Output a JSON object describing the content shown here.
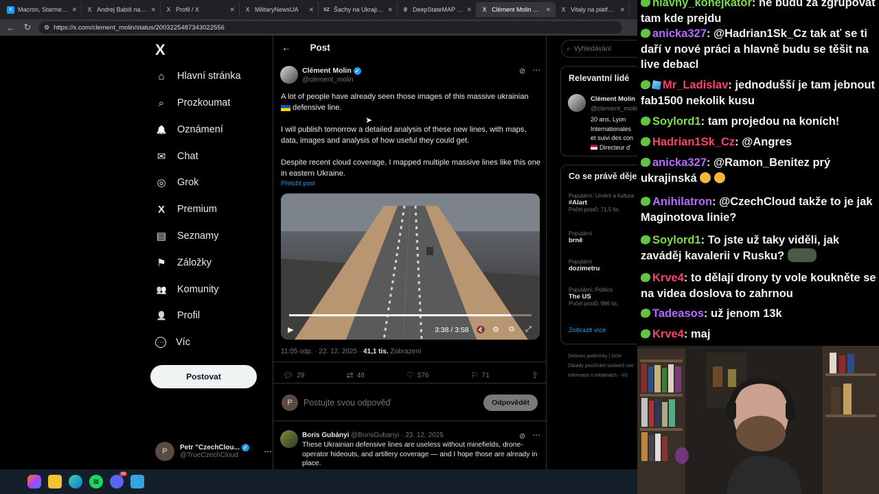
{
  "browser": {
    "tabs": [
      {
        "label": "Macron, Starmer a Ze",
        "icon": "X"
      },
      {
        "label": "Andrej Babiš na platf",
        "icon": "X"
      },
      {
        "label": "Profil / X",
        "icon": "X"
      },
      {
        "label": "MilitaryNewsUA",
        "icon": "X"
      },
      {
        "label": "Šachy na Ukrajině. Z",
        "icon": "SZ"
      },
      {
        "label": "DeepStateMAP | Дел",
        "icon": "₴"
      },
      {
        "label": "Clément Molin na pl",
        "icon": "X"
      },
      {
        "label": "Vitaly na platformě X",
        "icon": "X"
      }
    ],
    "url": "https://x.com/clement_molin/status/2003225487343022556"
  },
  "x": {
    "logo": "X",
    "nav": [
      {
        "label": "Hlavní stránka",
        "icon": "⌂"
      },
      {
        "label": "Prozkoumat",
        "icon": "⌕"
      },
      {
        "label": "Oznámení",
        "icon": "🔔"
      },
      {
        "label": "Chat",
        "icon": "✉"
      },
      {
        "label": "Grok",
        "icon": "◎"
      },
      {
        "label": "Premium",
        "icon": "X"
      },
      {
        "label": "Seznamy",
        "icon": "▤"
      },
      {
        "label": "Záložky",
        "icon": "⚑"
      },
      {
        "label": "Komunity",
        "icon": "👥"
      },
      {
        "label": "Profil",
        "icon": "👤"
      },
      {
        "label": "Víc",
        "icon": "⋯"
      }
    ],
    "post_button": "Postovat",
    "account": {
      "name": "Petr \"CzechClou...",
      "handle": "@TrueCzechCloud"
    },
    "header": {
      "back": "←",
      "title": "Post"
    },
    "post": {
      "author": "Clément Molin",
      "handle": "@clement_molin",
      "p1a": "A lot of people have already seen those images of this massive ukrainian",
      "p1b": "defensive line.",
      "p2": "I will publish tomorrow a detailed analysis of these new lines, with maps, data, images and analysis of how useful they could get.",
      "p3": "Despite recent cloud coverage, I mapped multiple massive lines like this one in eastern Ukraine.",
      "translate": "Přeložit post",
      "video_time": "3:38 / 3:58",
      "video_progress": 0.914,
      "timestamp": "11:05 odp. · 22. 12. 2025 ·",
      "views": "41,1 tis.",
      "views_label": "Zobrazení",
      "replies": "29",
      "reposts": "48",
      "likes": "576",
      "bookmarks": "71"
    },
    "reply_box": {
      "placeholder": "Postujte svou odpověď",
      "button": "Odpovědět"
    },
    "reply": {
      "author": "Boris Gubányi",
      "meta": "@BorisGubanyi · 23. 12. 2025",
      "text": "These Ukrainian defensive lines are useless without minefields, drone-operator hideouts, and artillery coverage — and I hope those are already in place."
    },
    "sidebar": {
      "search_placeholder": "Vyhledávání",
      "relevant_title": "Relevantní lidé",
      "relevant_name": "Clément Molin",
      "relevant_handle": "@clement_molin",
      "relevant_bio1": "20 ans, Lyon",
      "relevant_bio2": "Internationales",
      "relevant_bio3": "et suivi des con",
      "relevant_bio4": "Directeur d'",
      "trends_title": "Co se právě děje",
      "trends": [
        {
          "category": "Populární: Umění a kultura",
          "name": "#Alart",
          "count": "Počet postů: 71,5 tis."
        },
        {
          "category": "Populární",
          "name": "brně",
          "count": ""
        },
        {
          "category": "Populární",
          "name": "dozimetru",
          "count": ""
        },
        {
          "category": "Populární: Politics",
          "name": "The US",
          "count": "Počet postů: 986 tis."
        }
      ],
      "show_more": "Zobrazit více",
      "footer1": "Smluvní podmínky",
      "footer2": "Ochr",
      "footer3": "Zásady používání souborů coo",
      "footer4": "Informace o reklamách",
      "footer5": "Víc"
    }
  },
  "chat": {
    "messages": [
      {
        "user": "hlavny_konejkator",
        "text": "ne budu za zgrupovat tam kde prejdu",
        "color": "#7ddc4a"
      },
      {
        "user": "anicka327",
        "text": "@Hadrian1Sk_Cz tak ať se ti daří v nové práci a hlavně budu se těšit na live debacl",
        "color": "#b56bff"
      },
      {
        "user": "Mr_Ladislav",
        "text": "jednodušší je tam jebnout fab1500 nekolik kusu",
        "color": "#ff3f6c"
      },
      {
        "user": "Soylord1",
        "text": "tam projedou na koních!",
        "color": "#7ddc4a"
      },
      {
        "user": "Hadrian1Sk_Cz",
        "text": "@Angres",
        "color": "#ff3f6c"
      },
      {
        "user": "anicka327",
        "text": "@Ramon_Benitez prý ukrajinská",
        "color": "#b56bff"
      },
      {
        "user": "Anihilatron",
        "text": "@CzechCloud takže to je jak Maginotova linie?",
        "color": "#b56bff"
      },
      {
        "user": "Soylord1",
        "text": "To jste už taky viděli, jak zaváděj kavalerii v Rusku?",
        "color": "#7ddc4a"
      },
      {
        "user": "Krve4",
        "text": "to dělají drony ty vole koukněte se na videa doslova to zahrnou",
        "color": "#ff3f6c"
      },
      {
        "user": "Tadeasos",
        "text": "už jenom 13k",
        "color": "#b56bff"
      },
      {
        "user": "Krve4",
        "text": "maj",
        "color": "#ff3f6c"
      }
    ]
  },
  "taskbar": {
    "icons": [
      "windows-start",
      "copilot",
      "file-explorer",
      "edge",
      "spotify",
      "discord",
      "notepad"
    ],
    "discord_badge": "99"
  },
  "colors": {
    "accent": "#1d9bf0",
    "bg": "#000000",
    "border": "#2f3336",
    "muted": "#71767b"
  }
}
